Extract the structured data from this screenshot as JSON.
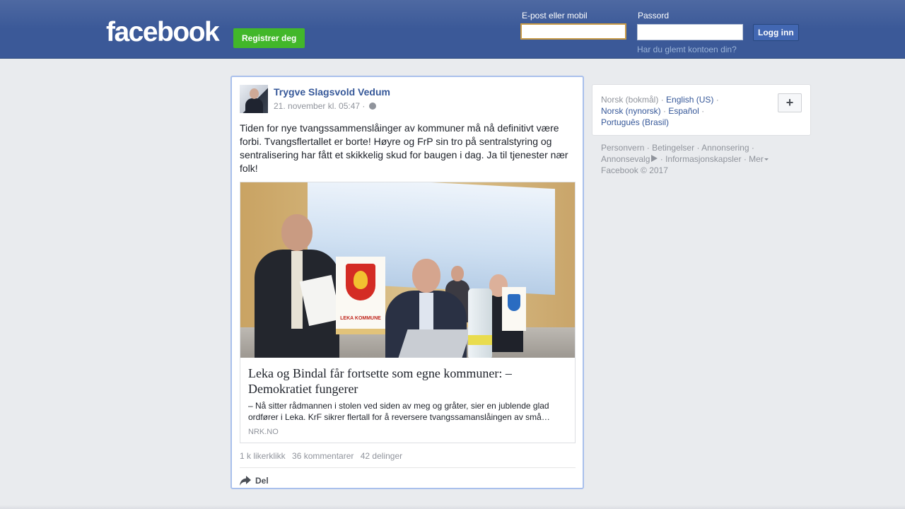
{
  "header": {
    "logo": "facebook",
    "register_label": "Registrer deg",
    "email_label": "E-post eller mobil",
    "email_value": "",
    "password_label": "Passord",
    "password_value": "",
    "login_label": "Logg inn",
    "forgot_link": "Har du glemt kontoen din?"
  },
  "post": {
    "author": "Trygve Slagsvold Vedum",
    "timestamp": "21. november kl. 05:47",
    "separator": "·",
    "privacy_icon": "globe-icon",
    "text": "Tiden for nye tvangssammenslåinger av kommuner må nå definitivt være forbi. Tvangsflertallet er borte! Høyre og FrP sin tro på sentralstyring og sentralisering har fått et skikkelig skud for baugen i dag. Ja til tjenester nær folk!",
    "link": {
      "image_text": "LEKA KOMMUNE",
      "title": "Leka og Bindal får fortsette som egne kommuner: – Demokratiet fungerer",
      "description": "– Nå sitter rådmannen i stolen ved siden av meg og gråter, sier en jublende glad ordfører i Leka. KrF sikrer flertall for å reversere tvangssamanslåingen av små…",
      "source": "NRK.NO"
    },
    "stats": {
      "likes": "1 k likerklikk",
      "comments": "36 kommentarer",
      "shares": "42 delinger"
    },
    "share_label": "Del"
  },
  "sidebar": {
    "languages": {
      "current": "Norsk (bokmål)",
      "english": "English (US)",
      "nynorsk": "Norsk (nynorsk)",
      "espanol": "Español",
      "portugues": "Português (Brasil)",
      "separator": "·"
    },
    "footer": {
      "privacy": "Personvern",
      "terms": "Betingelser",
      "advertising": "Annonsering",
      "adchoices": "Annonsevalg",
      "cookies": "Informasjonskapsler",
      "more": "Mer",
      "copyright": "Facebook © 2017"
    }
  },
  "colors": {
    "header_blue": "#3b5998",
    "register_green": "#42b72a",
    "link_blue": "#365899",
    "post_border": "#a9c0ec"
  }
}
